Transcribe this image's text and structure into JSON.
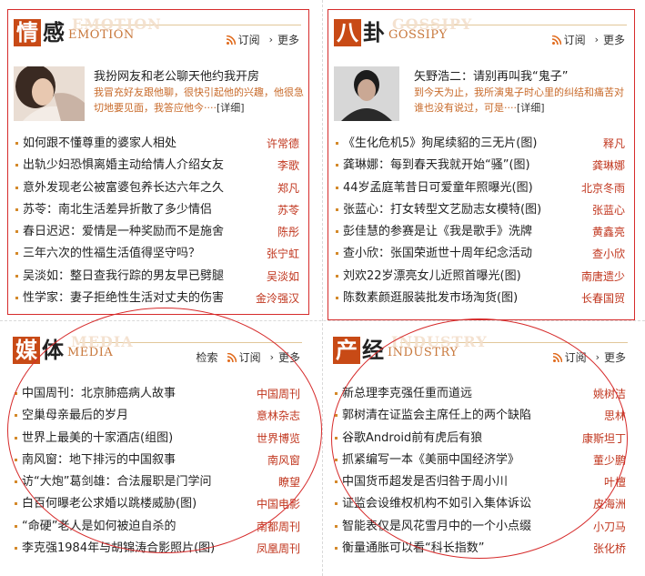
{
  "common": {
    "subscribe_label": "订阅",
    "more_label": "更多",
    "detail_label": "[详细]",
    "search_label": "检索"
  },
  "colors": {
    "accent": "#c84a16",
    "source_red": "#c0351d",
    "frame_red": "#d62b2b",
    "desc_orange": "#c86a2a"
  },
  "emotion": {
    "char1": "情",
    "char2": "感",
    "en": "EMOTION",
    "feature": {
      "title": "我扮网友和老公聊天他约我开房",
      "desc": "我冒充好友跟他聊，很快引起他的兴趣，他很急切地要见面，我答应他今····"
    },
    "items": [
      {
        "title": "如何跟不懂尊重的婆家人相处",
        "src": "许常德"
      },
      {
        "title": "出轨少妇恐惧离婚主动给情人介绍女友",
        "src": "李歌"
      },
      {
        "title": "意外发现老公被富婆包养长达六年之久",
        "src": "郑凡"
      },
      {
        "title": "苏苓：南北生活差异折散了多少情侣",
        "src": "苏苓"
      },
      {
        "title": "春日迟迟：爱情是一种奖励而不是施舍",
        "src": "陈彤"
      },
      {
        "title": "三年六次的性福生活值得坚守吗？",
        "src": "张宁虹"
      },
      {
        "title": "吴淡如：整日查我行踪的男友早已劈腿",
        "src": "吴淡如"
      },
      {
        "title": "性学家：妻子拒绝性生活对丈夫的伤害",
        "src": "金泠强汉"
      }
    ]
  },
  "gossip": {
    "char1": "八",
    "char2": "卦",
    "en": "GOSSIPY",
    "feature": {
      "title": "矢野浩二：请别再叫我“鬼子”",
      "desc": "到今天为止，我所演鬼子时心里的纠结和痛苦对谁也没有说过，可是····"
    },
    "items": [
      {
        "title": "《生化危机5》狗尾续貂的三无片(图)",
        "src": "释凡"
      },
      {
        "title": "龚琳娜：每到春天我就开始“骚”(图)",
        "src": "龚琳娜"
      },
      {
        "title": "44岁孟庭苇昔日可爱童年照曝光(图)",
        "src": "北京冬雨"
      },
      {
        "title": "张蓝心：打女转型文艺励志女模特(图)",
        "src": "张蓝心"
      },
      {
        "title": "彭佳慧的参赛是让《我是歌手》洗牌",
        "src": "黄鑫亮"
      },
      {
        "title": "查小欣：张国荣逝世十周年纪念活动",
        "src": "查小欣"
      },
      {
        "title": "刘欢22岁漂亮女儿近照首曝光(图)",
        "src": "南唐遗少"
      },
      {
        "title": "陈数素颜逛服装批发市场淘货(图)",
        "src": "长春国贸"
      }
    ]
  },
  "media": {
    "char1": "媒",
    "char2": "体",
    "en": "MEDIA",
    "items": [
      {
        "title": "中国周刊：北京肺癌病人故事",
        "src": "中国周刊"
      },
      {
        "title": "空巢母亲最后的岁月",
        "src": "意林杂志"
      },
      {
        "title": "世界上最美的十家酒店(组图)",
        "src": "世界博览"
      },
      {
        "title": "南风窗：地下排污的中国叙事",
        "src": "南风窗"
      },
      {
        "title": "访“大炮”葛剑雄：合法履职是门学问",
        "src": "瞭望"
      },
      {
        "title": "白百何曝老公求婚以跳楼威胁(图)",
        "src": "中国电影"
      },
      {
        "title": "“命硬”老人是如何被迫自杀的",
        "src": "南都周刊"
      },
      {
        "title": "李克强1984年与胡锦涛合影照片(图)",
        "src": "凤凰周刊"
      }
    ]
  },
  "industry": {
    "char1": "产",
    "char2": "经",
    "en": "INDUSTRY",
    "items": [
      {
        "title": "新总理李克强任重而道远",
        "src": "姚树洁"
      },
      {
        "title": "郭树清在证监会主席任上的两个缺陷",
        "src": "思林"
      },
      {
        "title": "谷歌Android前有虎后有狼",
        "src": "康斯坦丁"
      },
      {
        "title": "抓紧编写一本《美丽中国经济学》",
        "src": "董少鹏"
      },
      {
        "title": "中国货币超发是否归咎于周小川",
        "src": "叶檀"
      },
      {
        "title": "证监会设维权机构不如引入集体诉讼",
        "src": "皮海洲"
      },
      {
        "title": "智能表仅是风花雪月中的一个小点缀",
        "src": "小刀马"
      },
      {
        "title": "衡量通胀可以看“科长指数”",
        "src": "张化桥"
      }
    ]
  }
}
